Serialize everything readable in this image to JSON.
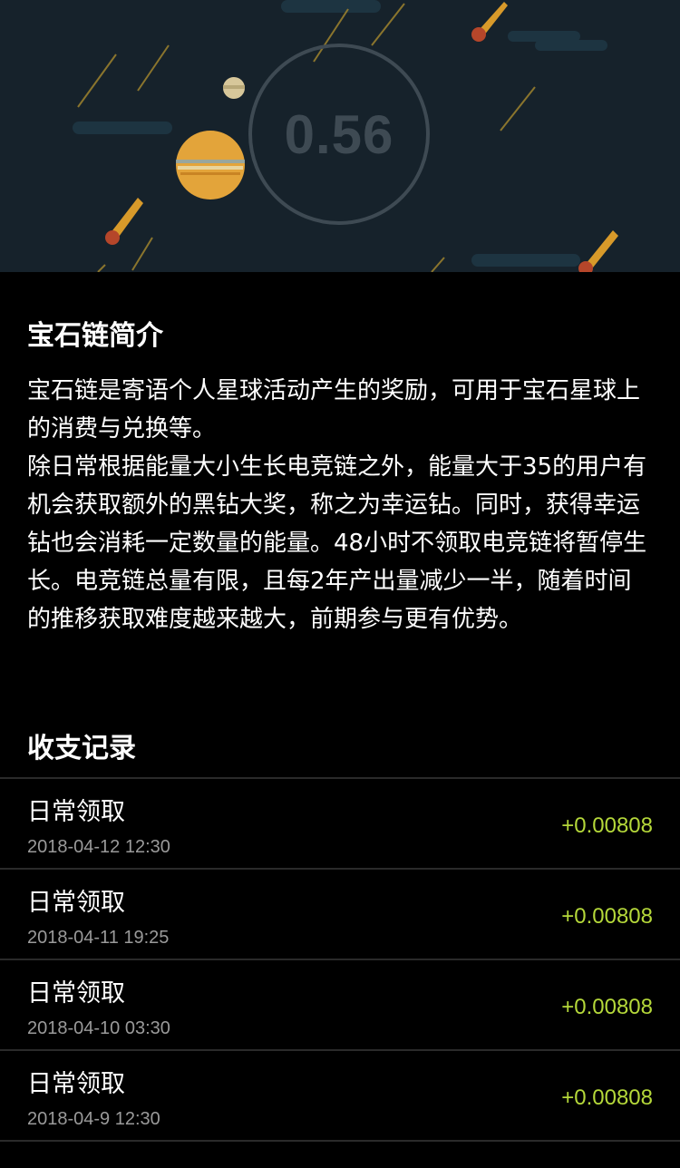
{
  "balance": {
    "value": "0.56"
  },
  "intro": {
    "title": "宝石链简介",
    "paragraphs": [
      "宝石链是寄语个人星球活动产生的奖励，可用于宝石星球上的消费与兑换等。",
      "除日常根据能量大小生长电竞链之外，能量大于35的用户有机会获取额外的黑钻大奖，称之为幸运钻。同时，获得幸运钻也会消耗一定数量的能量。48小时不领取电竞链将暂停生长。电竞链总量有限，且每2年产出量减少一半，随着时间的推移获取难度越来越大，前期参与更有优势。"
    ]
  },
  "records": {
    "title": "收支记录",
    "items": [
      {
        "label": "日常领取",
        "time": "2018-04-12 12:30",
        "amount": "+0.00808"
      },
      {
        "label": "日常领取",
        "time": "2018-04-11 19:25",
        "amount": "+0.00808"
      },
      {
        "label": "日常领取",
        "time": "2018-04-10 03:30",
        "amount": "+0.00808"
      },
      {
        "label": "日常领取",
        "time": "2018-04-9 12:30",
        "amount": "+0.00808"
      }
    ]
  },
  "colors": {
    "hero_background": "#16222b",
    "amount_positive": "#b5d83a",
    "planet": "#e3a43a",
    "meteor": "#d89a2a"
  }
}
